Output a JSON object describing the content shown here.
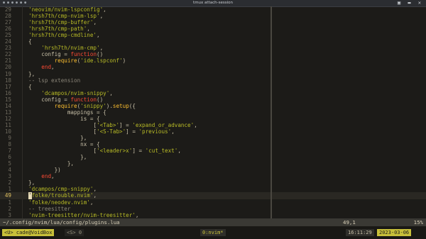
{
  "window": {
    "dots": "● ● ● ● ● ●",
    "title": "tmux attach-session",
    "controls": "▣ ▬ ✕"
  },
  "editor": {
    "current_line": "49",
    "lines": [
      {
        "n": "29",
        "t": [
          [
            "'neovim/nvim-lspconfig'",
            "s"
          ],
          [
            ",",
            "p"
          ]
        ]
      },
      {
        "n": "28",
        "t": [
          [
            "'hrsh7th/cmp-nvim-lsp'",
            "s"
          ],
          [
            ",",
            "p"
          ]
        ]
      },
      {
        "n": "27",
        "t": [
          [
            "'hrsh7th/cmp-buffer'",
            "s"
          ],
          [
            ",",
            "p"
          ]
        ]
      },
      {
        "n": "26",
        "t": [
          [
            "'hrsh7th/cmp-path'",
            "s"
          ],
          [
            ",",
            "p"
          ]
        ]
      },
      {
        "n": "25",
        "t": [
          [
            "'hrsh7th/cmp-cmdline'",
            "s"
          ],
          [
            ",",
            "p"
          ]
        ]
      },
      {
        "n": "24",
        "t": [
          [
            "{",
            "p"
          ]
        ]
      },
      {
        "n": "23",
        "t": [
          [
            "    'hrsh7th/nvim-cmp'",
            "s"
          ],
          [
            ",",
            "p"
          ]
        ]
      },
      {
        "n": "22",
        "t": [
          [
            "    config = ",
            "p"
          ],
          [
            "function",
            "k"
          ],
          [
            "()",
            "p"
          ]
        ]
      },
      {
        "n": "21",
        "t": [
          [
            "        ",
            "p"
          ],
          [
            "require",
            "f"
          ],
          [
            "(",
            "p"
          ],
          [
            "'ide.lspconf'",
            "s"
          ],
          [
            ")",
            "p"
          ]
        ]
      },
      {
        "n": "20",
        "t": [
          [
            "    ",
            "p"
          ],
          [
            "end",
            "k"
          ],
          [
            ",",
            "p"
          ]
        ]
      },
      {
        "n": "19",
        "t": [
          [
            "},",
            "p"
          ]
        ]
      },
      {
        "n": "18",
        "t": [
          [
            "-- lsp extension",
            "c"
          ]
        ]
      },
      {
        "n": "17",
        "t": [
          [
            "{",
            "p"
          ]
        ]
      },
      {
        "n": "16",
        "t": [
          [
            "    'dcampos/nvim-snippy'",
            "s"
          ],
          [
            ",",
            "p"
          ]
        ]
      },
      {
        "n": "15",
        "t": [
          [
            "    config = ",
            "p"
          ],
          [
            "function",
            "k"
          ],
          [
            "()",
            "p"
          ]
        ]
      },
      {
        "n": "14",
        "t": [
          [
            "        ",
            "p"
          ],
          [
            "require",
            "f"
          ],
          [
            "(",
            "p"
          ],
          [
            "'snippy'",
            "s"
          ],
          [
            ").",
            "p"
          ],
          [
            "setup",
            "f"
          ],
          [
            "({",
            "p"
          ]
        ]
      },
      {
        "n": "13",
        "t": [
          [
            "            mappings = {",
            "p"
          ]
        ]
      },
      {
        "n": "12",
        "t": [
          [
            "                is = {",
            "p"
          ]
        ]
      },
      {
        "n": "11",
        "t": [
          [
            "                    [",
            "p"
          ],
          [
            "'<Tab>'",
            "s"
          ],
          [
            "] = ",
            "p"
          ],
          [
            "'expand_or_advance'",
            "s"
          ],
          [
            ",",
            "p"
          ]
        ]
      },
      {
        "n": "10",
        "t": [
          [
            "                    [",
            "p"
          ],
          [
            "'<S-Tab>'",
            "s"
          ],
          [
            "] = ",
            "p"
          ],
          [
            "'previous'",
            "s"
          ],
          [
            ",",
            "p"
          ]
        ]
      },
      {
        "n": "9",
        "t": [
          [
            "                },",
            "p"
          ]
        ]
      },
      {
        "n": "8",
        "t": [
          [
            "                nx = {",
            "p"
          ]
        ]
      },
      {
        "n": "7",
        "t": [
          [
            "                    [",
            "p"
          ],
          [
            "'<leader>x'",
            "s"
          ],
          [
            "] = ",
            "p"
          ],
          [
            "'cut_text'",
            "s"
          ],
          [
            ",",
            "p"
          ]
        ]
      },
      {
        "n": "6",
        "t": [
          [
            "                },",
            "p"
          ]
        ]
      },
      {
        "n": "5",
        "t": [
          [
            "            },",
            "p"
          ]
        ]
      },
      {
        "n": "4",
        "t": [
          [
            "        })",
            "p"
          ]
        ]
      },
      {
        "n": "3",
        "t": [
          [
            "    ",
            "p"
          ],
          [
            "end",
            "k"
          ],
          [
            ",",
            "p"
          ]
        ]
      },
      {
        "n": "2",
        "t": [
          [
            "},",
            "p"
          ]
        ]
      },
      {
        "n": "1",
        "t": [
          [
            "'dcampos/cmp-snippy'",
            "s"
          ],
          [
            ",",
            "p"
          ]
        ]
      },
      {
        "n": "49",
        "cur": true,
        "t": [
          [
            "'",
            "cursor"
          ],
          [
            "folke/trouble.nvim'",
            "s"
          ],
          [
            ",",
            "p"
          ]
        ]
      },
      {
        "n": "1",
        "t": [
          [
            "'folke/neodev.nvim'",
            "s"
          ],
          [
            ",",
            "p"
          ]
        ]
      },
      {
        "n": "2",
        "t": [
          [
            "-- treesitter",
            "c"
          ]
        ]
      },
      {
        "n": "3",
        "t": [
          [
            "'nvim-treesitter/nvim-treesitter'",
            "s"
          ],
          [
            ",",
            "p"
          ]
        ]
      }
    ]
  },
  "statusline": {
    "path": "~/.config/nvim/lua/config/plugins.lua",
    "position": "49,1",
    "percent": "15%"
  },
  "tmux": {
    "session": "<U> cade@VoidBox",
    "s_label": "<S> 0",
    "window": "0:nvim*",
    "time": "16:11:29",
    "date": "2023-03-06"
  }
}
